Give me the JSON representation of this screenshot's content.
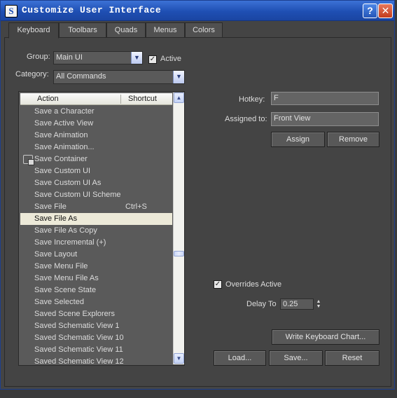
{
  "window": {
    "title": "Customize User Interface",
    "icon_letter": "S",
    "help_label": "?",
    "close_label": "✕"
  },
  "tabs": [
    {
      "label": "Keyboard",
      "active": true
    },
    {
      "label": "Toolbars",
      "active": false
    },
    {
      "label": "Quads",
      "active": false
    },
    {
      "label": "Menus",
      "active": false
    },
    {
      "label": "Colors",
      "active": false
    }
  ],
  "group": {
    "label": "Group:",
    "value": "Main UI"
  },
  "active_checkbox": {
    "label": "Active",
    "checked": true
  },
  "category": {
    "label": "Category:",
    "value": "All Commands"
  },
  "action_list": {
    "columns": {
      "action": "Action",
      "shortcut": "Shortcut"
    },
    "rows": [
      {
        "action": "Save a Character",
        "shortcut": ""
      },
      {
        "action": "Save Active View",
        "shortcut": ""
      },
      {
        "action": "Save Animation",
        "shortcut": ""
      },
      {
        "action": "Save Animation...",
        "shortcut": ""
      },
      {
        "action": "Save Container",
        "shortcut": "",
        "icon": "container-icon"
      },
      {
        "action": "Save Custom UI",
        "shortcut": ""
      },
      {
        "action": "Save Custom UI As",
        "shortcut": ""
      },
      {
        "action": "Save Custom UI Scheme",
        "shortcut": ""
      },
      {
        "action": "Save File",
        "shortcut": "Ctrl+S"
      },
      {
        "action": "Save File As",
        "shortcut": "",
        "selected": true
      },
      {
        "action": "Save File As Copy",
        "shortcut": ""
      },
      {
        "action": "Save Incremental (+)",
        "shortcut": ""
      },
      {
        "action": "Save Layout",
        "shortcut": ""
      },
      {
        "action": "Save Menu File",
        "shortcut": ""
      },
      {
        "action": "Save Menu File As",
        "shortcut": ""
      },
      {
        "action": "Save Scene State",
        "shortcut": ""
      },
      {
        "action": "Save Selected",
        "shortcut": ""
      },
      {
        "action": "Saved Scene Explorers",
        "shortcut": ""
      },
      {
        "action": "Saved Schematic View 1",
        "shortcut": ""
      },
      {
        "action": "Saved Schematic View 10",
        "shortcut": ""
      },
      {
        "action": "Saved Schematic View 11",
        "shortcut": ""
      },
      {
        "action": "Saved Schematic View 12",
        "shortcut": ""
      }
    ]
  },
  "hotkey": {
    "label": "Hotkey:",
    "value": "F"
  },
  "assigned_to": {
    "label": "Assigned to:",
    "value": "Front View"
  },
  "buttons": {
    "assign": "Assign",
    "remove": "Remove",
    "write_chart": "Write Keyboard Chart...",
    "load": "Load...",
    "save": "Save...",
    "reset": "Reset"
  },
  "overrides": {
    "label": "Overrides Active",
    "checked": true
  },
  "delay": {
    "label": "Delay To",
    "value": "0.25"
  },
  "colors": {
    "titlebar": "#1f4fb3",
    "panel": "#444444",
    "selection": "#ece9d8"
  }
}
